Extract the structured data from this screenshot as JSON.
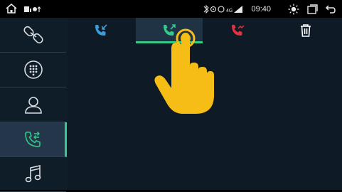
{
  "status_bar": {
    "time": "09:40",
    "icons": [
      "home-icon",
      "notification-icons",
      "bluetooth-icon",
      "location-icon",
      "signal-4g-icon",
      "brightness-icon",
      "window-icon",
      "back-icon"
    ]
  },
  "sidebar": {
    "items": [
      {
        "name": "link-icon",
        "active": false
      },
      {
        "name": "dialpad-icon",
        "active": false
      },
      {
        "name": "contacts-icon",
        "active": false
      },
      {
        "name": "call-log-icon",
        "active": true
      },
      {
        "name": "music-icon",
        "active": false
      }
    ]
  },
  "tabs": [
    {
      "name": "incoming-calls",
      "icon": "incoming-call-icon",
      "color": "#3a9cd8",
      "active": false
    },
    {
      "name": "outgoing-calls",
      "icon": "outgoing-call-icon",
      "color": "#35c98b",
      "active": true
    },
    {
      "name": "missed-calls",
      "icon": "missed-call-icon",
      "color": "#e0333d",
      "active": false
    },
    {
      "name": "delete",
      "icon": "trash-icon",
      "color": "#ffffff",
      "active": false
    }
  ],
  "colors": {
    "accent": "#35c98b",
    "sidebar_bg": "#0f1d28",
    "main_bg": "#0e1b26",
    "hand": "#f6bd17"
  }
}
